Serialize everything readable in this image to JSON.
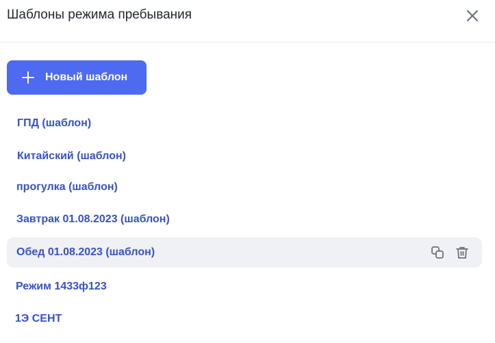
{
  "dialog": {
    "title": "Шаблоны режима пребывания",
    "close_icon": "close-icon"
  },
  "new_template_button": {
    "label": "Новый шаблон",
    "icon": "plus-icon",
    "color": "#4d6af0"
  },
  "templates": [
    {
      "label": "ГПД (шаблон)"
    },
    {
      "label": "Китайский (шаблон)"
    },
    {
      "label": "прогулка (шаблон)"
    },
    {
      "label": "Завтрак 01.08.2023 (шаблон)"
    },
    {
      "label": "Обед 01.08.2023 (шаблон)",
      "hovered": true,
      "actions": [
        "copy-icon",
        "trash-icon"
      ]
    },
    {
      "label": "Режим 1433ф123"
    },
    {
      "label": "1Э СЕНТ"
    }
  ],
  "colors": {
    "link": "#3651c9",
    "hover_bg": "#f0f1f5",
    "icon_gray": "#6b6f7a"
  }
}
